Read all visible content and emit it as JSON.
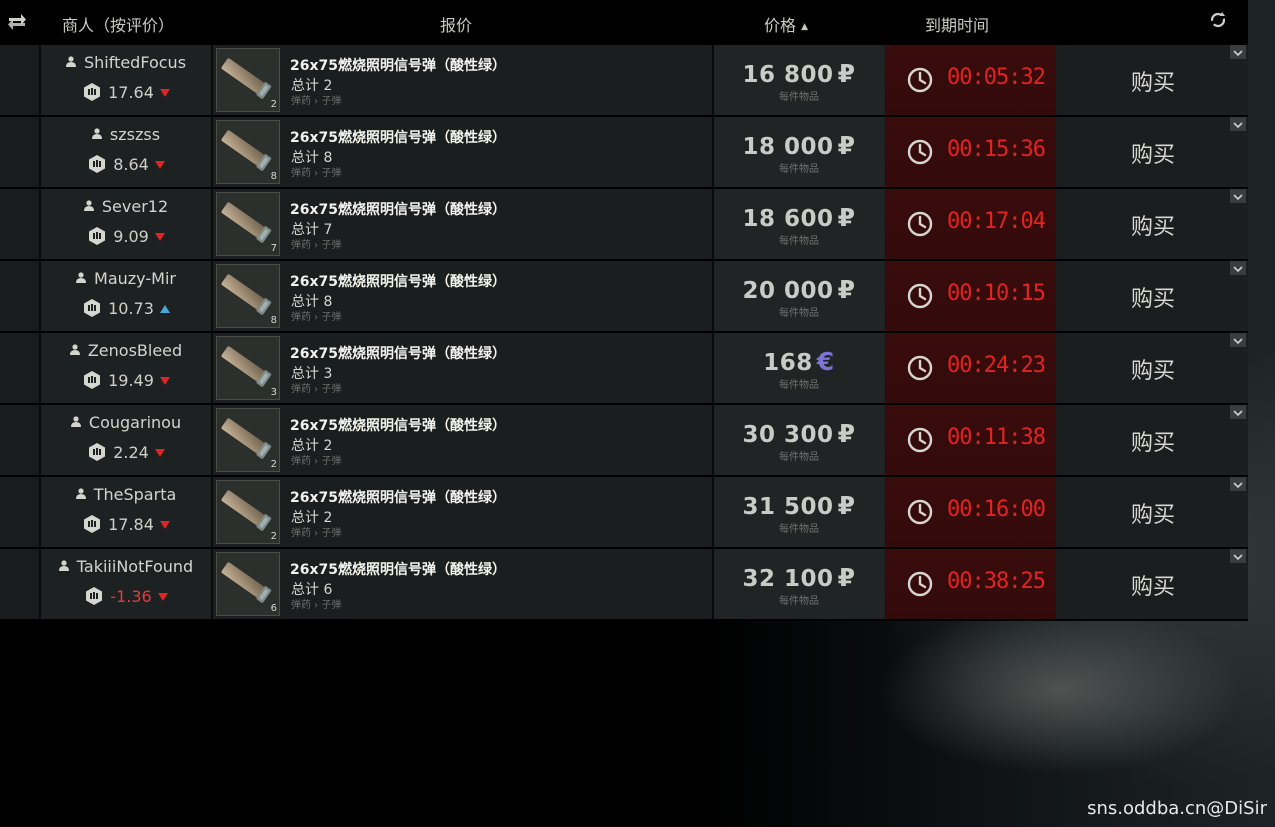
{
  "header": {
    "seller_col": "商人（按评价）",
    "offer_col": "报价",
    "price_col": "价格",
    "sort_indicator": "▲",
    "expiry_col": "到期时间",
    "refresh_left_icon": "swap-refresh-icon",
    "refresh_right_icon": "reload-icon"
  },
  "colors": {
    "timer_red": "#e02424",
    "euro_purple": "#7c74d6",
    "trend_down": "#e02424",
    "trend_up": "#4aa8d8"
  },
  "offers": [
    {
      "seller": "ShiftedFocus",
      "rating": "17.64",
      "trend": "down",
      "item": "26x75燃烧照明信号弹（酸性绿）",
      "total": "总计 2",
      "category": "弹药 › 子弹",
      "qty": "2",
      "price": "16 800",
      "currency": "₽",
      "price_sub": "每件物品",
      "time": "00:05:32",
      "buy": "购买"
    },
    {
      "seller": "szszss",
      "rating": "8.64",
      "trend": "down",
      "item": "26x75燃烧照明信号弹（酸性绿）",
      "total": "总计 8",
      "category": "弹药 › 子弹",
      "qty": "8",
      "price": "18 000",
      "currency": "₽",
      "price_sub": "每件物品",
      "time": "00:15:36",
      "buy": "购买"
    },
    {
      "seller": "Sever12",
      "rating": "9.09",
      "trend": "down",
      "item": "26x75燃烧照明信号弹（酸性绿）",
      "total": "总计 7",
      "category": "弹药 › 子弹",
      "qty": "7",
      "price": "18 600",
      "currency": "₽",
      "price_sub": "每件物品",
      "time": "00:17:04",
      "buy": "购买"
    },
    {
      "seller": "Mauzy-Mir",
      "rating": "10.73",
      "trend": "up",
      "item": "26x75燃烧照明信号弹（酸性绿）",
      "total": "总计 8",
      "category": "弹药 › 子弹",
      "qty": "8",
      "price": "20 000",
      "currency": "₽",
      "price_sub": "每件物品",
      "time": "00:10:15",
      "buy": "购买"
    },
    {
      "seller": "ZenosBleed",
      "rating": "19.49",
      "trend": "down",
      "item": "26x75燃烧照明信号弹（酸性绿）",
      "total": "总计 3",
      "category": "弹药 › 子弹",
      "qty": "3",
      "price": "168",
      "currency": "€",
      "price_sub": "每件物品",
      "time": "00:24:23",
      "buy": "购买"
    },
    {
      "seller": "Cougarinou",
      "rating": "2.24",
      "trend": "down",
      "item": "26x75燃烧照明信号弹（酸性绿）",
      "total": "总计 2",
      "category": "弹药 › 子弹",
      "qty": "2",
      "price": "30 300",
      "currency": "₽",
      "price_sub": "每件物品",
      "time": "00:11:38",
      "buy": "购买"
    },
    {
      "seller": "TheSparta",
      "rating": "17.84",
      "trend": "down",
      "item": "26x75燃烧照明信号弹（酸性绿）",
      "total": "总计 2",
      "category": "弹药 › 子弹",
      "qty": "2",
      "price": "31 500",
      "currency": "₽",
      "price_sub": "每件物品",
      "time": "00:16:00",
      "buy": "购买"
    },
    {
      "seller": "TakiiiNotFound",
      "rating": "-1.36",
      "trend": "down",
      "item": "26x75燃烧照明信号弹（酸性绿）",
      "total": "总计 6",
      "category": "弹药 › 子弹",
      "qty": "6",
      "price": "32 100",
      "currency": "₽",
      "price_sub": "每件物品",
      "time": "00:38:25",
      "buy": "购买"
    }
  ],
  "watermark": "sns.oddba.cn@DiSir"
}
